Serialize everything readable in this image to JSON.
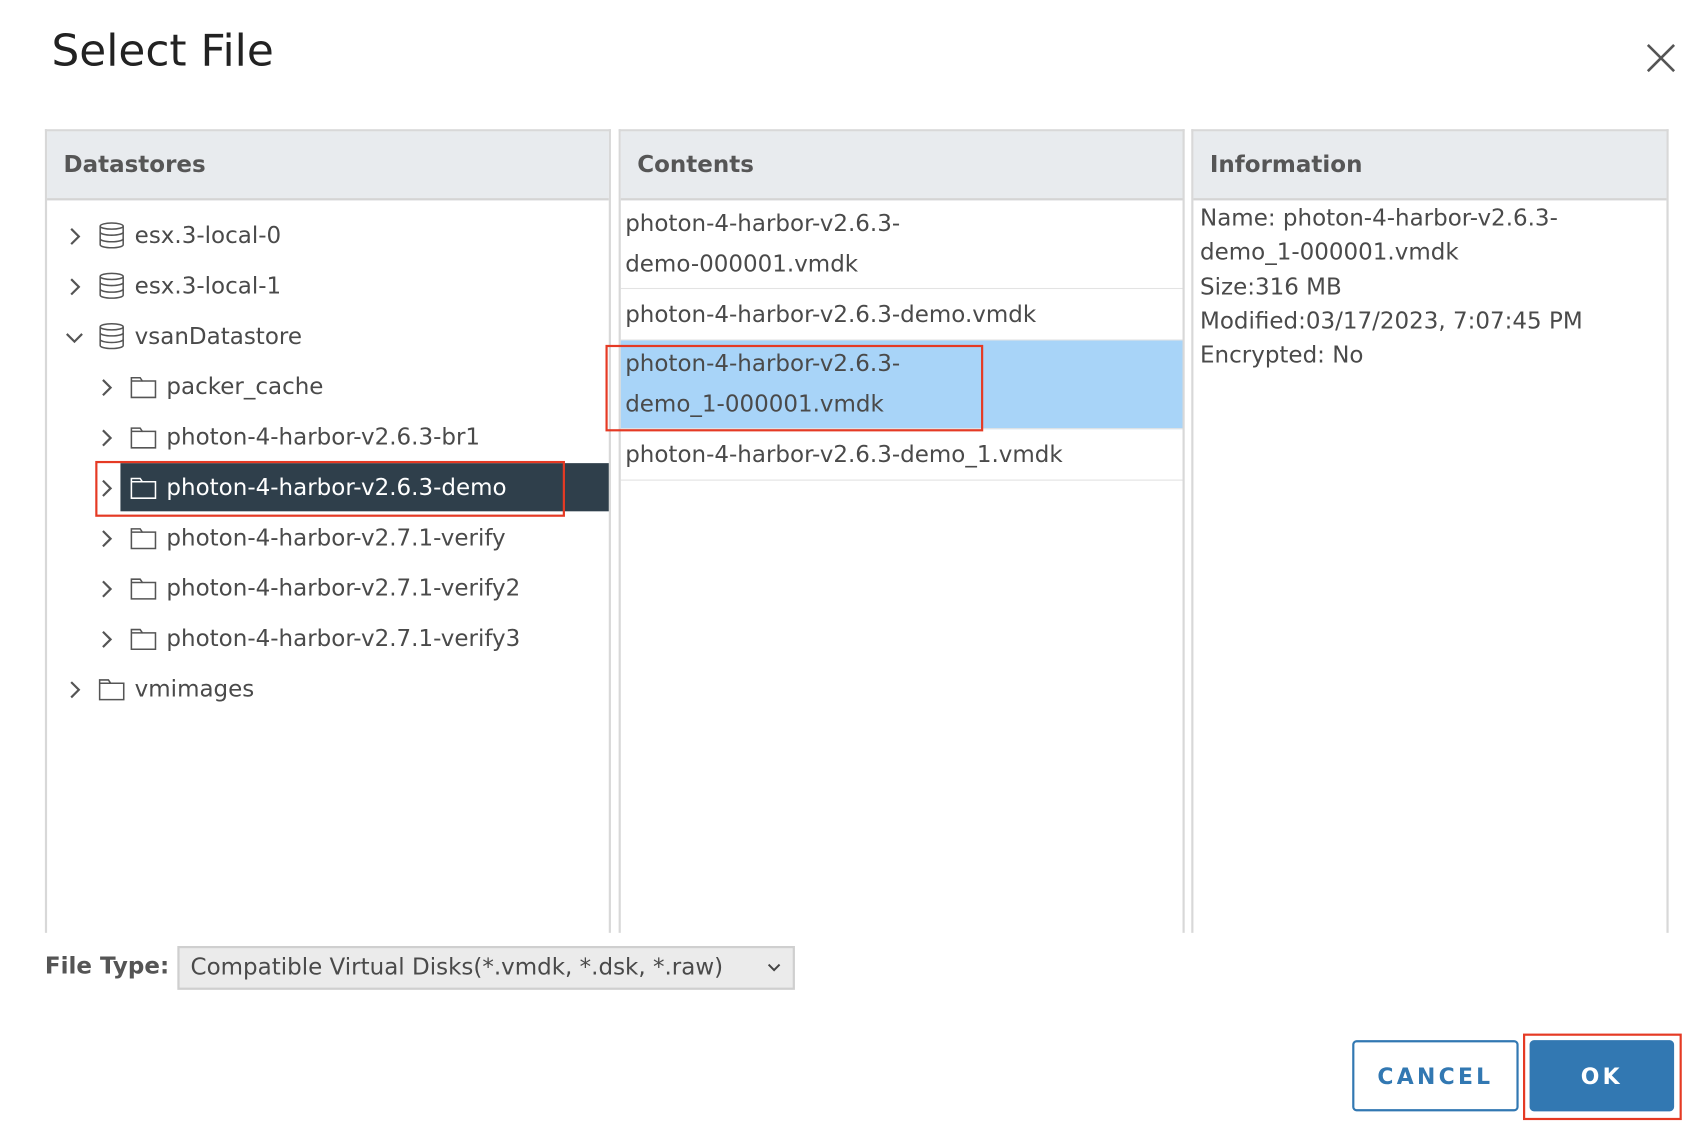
{
  "dialog": {
    "title": "Select File",
    "close_icon": "close-x-icon"
  },
  "datastores": {
    "header": "Datastores",
    "items": [
      {
        "label": "esx.3-local-0",
        "level": 0,
        "icon": "database-icon",
        "expanded": false
      },
      {
        "label": "esx.3-local-1",
        "level": 0,
        "icon": "database-icon",
        "expanded": false
      },
      {
        "label": "vsanDatastore",
        "level": 0,
        "icon": "database-icon",
        "expanded": true
      },
      {
        "label": "packer_cache",
        "level": 1,
        "icon": "folder-icon",
        "expanded": false
      },
      {
        "label": "photon-4-harbor-v2.6.3-br1",
        "level": 1,
        "icon": "folder-icon",
        "expanded": false
      },
      {
        "label": "photon-4-harbor-v2.6.3-demo",
        "level": 1,
        "icon": "folder-icon",
        "expanded": false,
        "selected": true
      },
      {
        "label": "photon-4-harbor-v2.7.1-verify",
        "level": 1,
        "icon": "folder-icon",
        "expanded": false
      },
      {
        "label": "photon-4-harbor-v2.7.1-verify2",
        "level": 1,
        "icon": "folder-icon",
        "expanded": false
      },
      {
        "label": "photon-4-harbor-v2.7.1-verify3",
        "level": 1,
        "icon": "folder-icon",
        "expanded": false
      },
      {
        "label": "vmimages",
        "level": 0,
        "icon": "folder-icon",
        "expanded": false
      }
    ]
  },
  "contents": {
    "header": "Contents",
    "items": [
      {
        "line1": "photon-4-harbor-v2.6.3-",
        "line2": "demo-000001.vmdk"
      },
      {
        "line1": "photon-4-harbor-v2.6.3-demo.vmdk",
        "line2": ""
      },
      {
        "line1": "photon-4-harbor-v2.6.3-",
        "line2": "demo_1-000001.vmdk",
        "selected": true
      },
      {
        "line1": "photon-4-harbor-v2.6.3-demo_1.vmdk",
        "line2": ""
      }
    ]
  },
  "information": {
    "header": "Information",
    "lines": [
      "Name: photon-4-harbor-v2.6.3-",
      "demo_1-000001.vmdk",
      "Size:316 MB",
      "Modified:03/17/2023, 7:07:45 PM",
      "Encrypted: No"
    ]
  },
  "file_type": {
    "label": "File Type:",
    "value": "Compatible Virtual Disks(*.vmdk, *.dsk, *.raw)"
  },
  "buttons": {
    "cancel": "CANCEL",
    "ok": "OK"
  },
  "colors": {
    "primary": "#3278b2",
    "tree_selected": "#2f3f4b",
    "content_selected": "#a8d4f8",
    "highlight": "#e53a24"
  }
}
